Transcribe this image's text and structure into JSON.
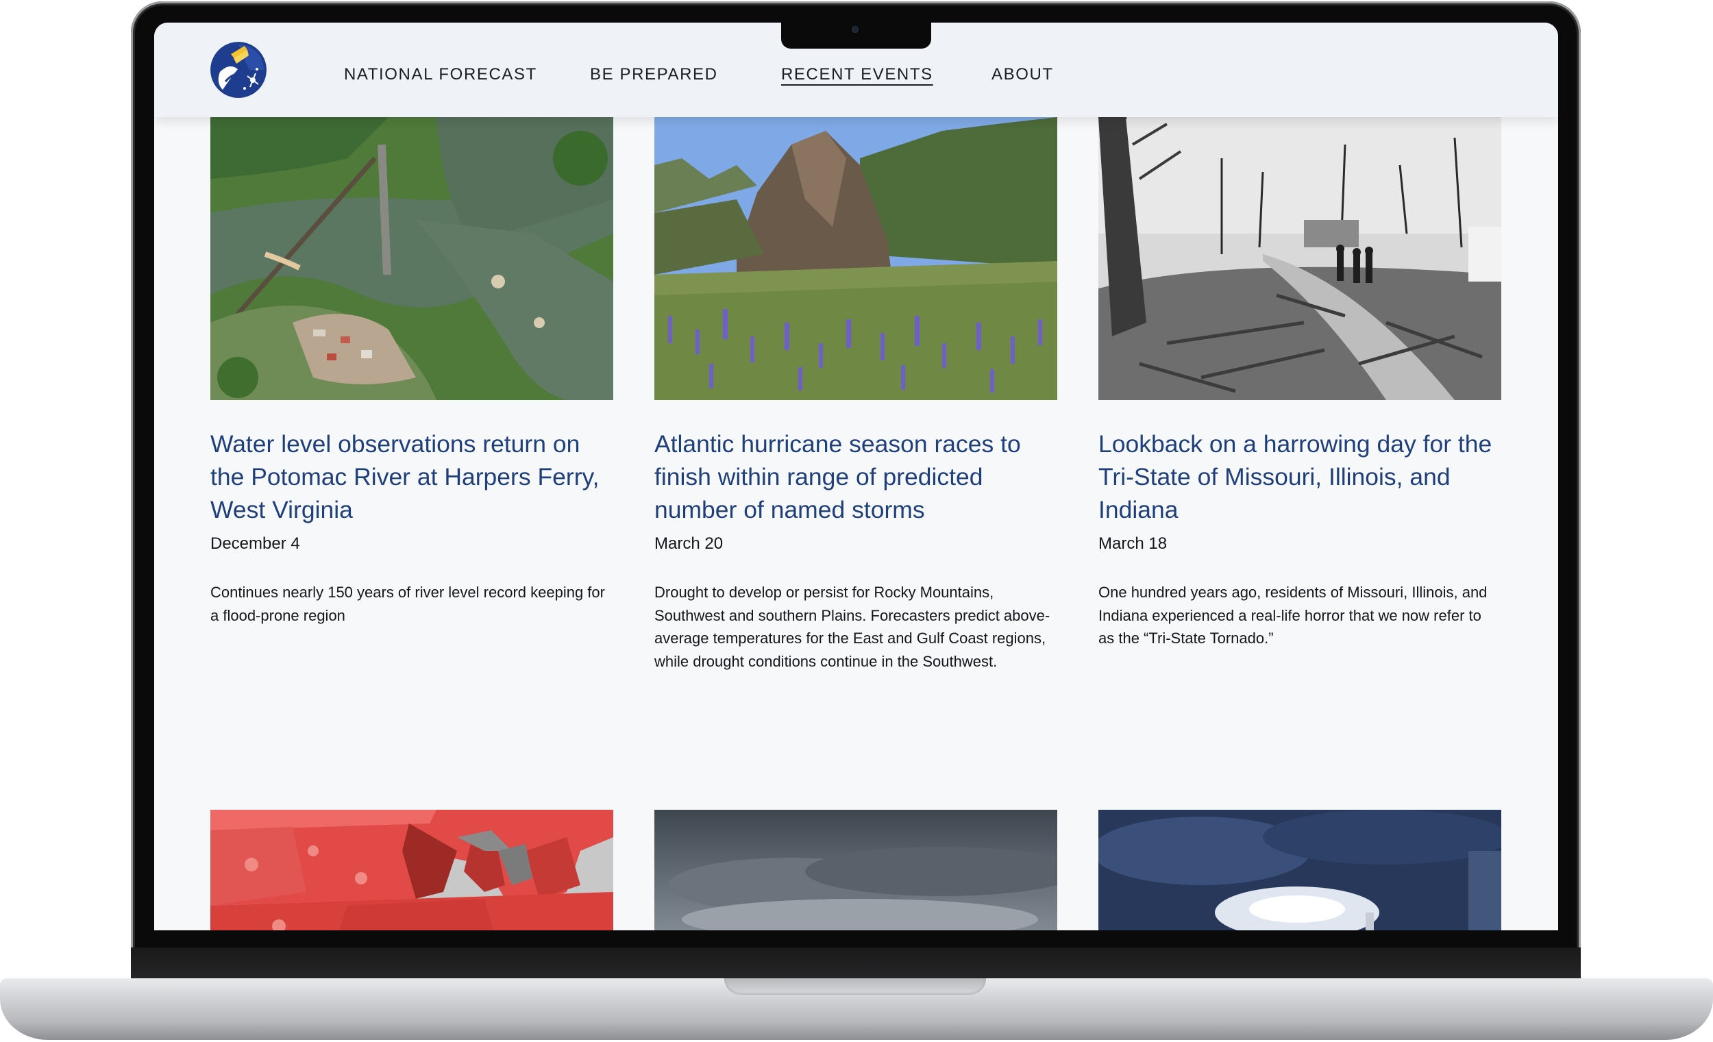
{
  "nav": {
    "items": [
      {
        "label": "NATIONAL FORECAST"
      },
      {
        "label": "BE PREPARED"
      },
      {
        "label": "RECENT EVENTS"
      },
      {
        "label": "ABOUT"
      }
    ]
  },
  "articles": [
    {
      "title": "Water level observations return on the Potomac River at Harpers Ferry, West Virginia",
      "date": "December 4",
      "summary": "Continues nearly 150 years of river level record keeping for a flood-prone region"
    },
    {
      "title": "Atlantic hurricane season races to finish within range of predicted number of named storms",
      "date": "March 20",
      "summary": "Drought to develop or persist for Rocky Mountains, Southwest and southern Plains. Forecasters predict above-average temperatures for the East and Gulf Coast regions, while drought conditions continue in the Southwest."
    },
    {
      "title": "Lookback on a harrowing day for the Tri-State of Missouri, Illinois, and Indiana",
      "date": "March 18",
      "summary": "One hundred years ago, residents of Missouri, Illinois, and Indiana experienced a real-life horror that we now refer to as the “Tri-State Tornado.”"
    }
  ],
  "colors": {
    "link": "#1f3f7a",
    "header_bg": "#eff2f6",
    "page_bg": "#f7f8fa",
    "logo_blue": "#1e3d8f",
    "logo_gold": "#f2c230"
  },
  "icons": {
    "logo": "sun-weather-logo-icon"
  }
}
